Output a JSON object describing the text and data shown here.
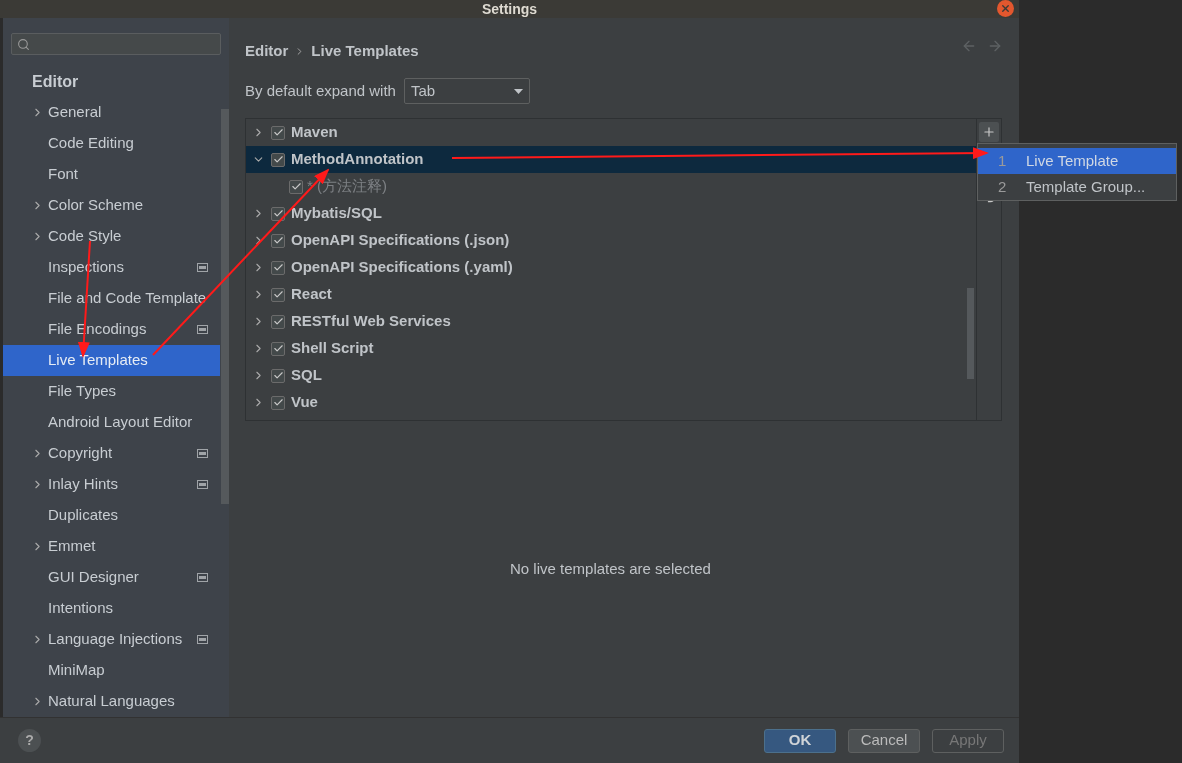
{
  "window": {
    "title": "Settings"
  },
  "sidebar": {
    "heading": "Editor",
    "items": [
      {
        "label": "General",
        "expandable": true,
        "badge": false,
        "selected": false
      },
      {
        "label": "Code Editing",
        "expandable": false,
        "badge": false,
        "selected": false
      },
      {
        "label": "Font",
        "expandable": false,
        "badge": false,
        "selected": false
      },
      {
        "label": "Color Scheme",
        "expandable": true,
        "badge": false,
        "selected": false
      },
      {
        "label": "Code Style",
        "expandable": true,
        "badge": false,
        "selected": false
      },
      {
        "label": "Inspections",
        "expandable": false,
        "badge": true,
        "selected": false
      },
      {
        "label": "File and Code Template",
        "expandable": false,
        "badge": false,
        "selected": false
      },
      {
        "label": "File Encodings",
        "expandable": false,
        "badge": true,
        "selected": false
      },
      {
        "label": "Live Templates",
        "expandable": false,
        "badge": false,
        "selected": true
      },
      {
        "label": "File Types",
        "expandable": false,
        "badge": false,
        "selected": false
      },
      {
        "label": "Android Layout Editor",
        "expandable": false,
        "badge": false,
        "selected": false
      },
      {
        "label": "Copyright",
        "expandable": true,
        "badge": true,
        "selected": false
      },
      {
        "label": "Inlay Hints",
        "expandable": true,
        "badge": true,
        "selected": false
      },
      {
        "label": "Duplicates",
        "expandable": false,
        "badge": false,
        "selected": false
      },
      {
        "label": "Emmet",
        "expandable": true,
        "badge": false,
        "selected": false
      },
      {
        "label": "GUI Designer",
        "expandable": false,
        "badge": true,
        "selected": false
      },
      {
        "label": "Intentions",
        "expandable": false,
        "badge": false,
        "selected": false
      },
      {
        "label": "Language Injections",
        "expandable": true,
        "badge": true,
        "selected": false
      },
      {
        "label": "MiniMap",
        "expandable": false,
        "badge": false,
        "selected": false
      },
      {
        "label": "Natural Languages",
        "expandable": true,
        "badge": false,
        "selected": false
      }
    ]
  },
  "breadcrumb": [
    "Editor",
    "Live Templates"
  ],
  "expand_with": {
    "label": "By default expand with",
    "value": "Tab"
  },
  "template_groups": [
    {
      "label": "Maven",
      "checked": true,
      "expanded": false,
      "selected": false
    },
    {
      "label": "MethodAnnotation",
      "checked": true,
      "expanded": true,
      "selected": true,
      "children": [
        {
          "label": "* (方法注释)",
          "checked": true
        }
      ]
    },
    {
      "label": "Mybatis/SQL",
      "checked": true,
      "expanded": false,
      "selected": false
    },
    {
      "label": "OpenAPI Specifications (.json)",
      "checked": true,
      "expanded": false,
      "selected": false
    },
    {
      "label": "OpenAPI Specifications (.yaml)",
      "checked": true,
      "expanded": false,
      "selected": false
    },
    {
      "label": "React",
      "checked": true,
      "expanded": false,
      "selected": false
    },
    {
      "label": "RESTful Web Services",
      "checked": true,
      "expanded": false,
      "selected": false
    },
    {
      "label": "Shell Script",
      "checked": true,
      "expanded": false,
      "selected": false
    },
    {
      "label": "SQL",
      "checked": true,
      "expanded": false,
      "selected": false
    },
    {
      "label": "Vue",
      "checked": true,
      "expanded": false,
      "selected": false
    }
  ],
  "empty_message": "No live templates are selected",
  "add_menu": [
    {
      "number": "1",
      "label": "Live Template",
      "selected": true
    },
    {
      "number": "2",
      "label": "Template Group...",
      "selected": false
    }
  ],
  "help_button": "?",
  "buttons": [
    {
      "label": "OK",
      "kind": "primary"
    },
    {
      "label": "Cancel",
      "kind": "default"
    },
    {
      "label": "Apply",
      "kind": "disabled"
    }
  ]
}
